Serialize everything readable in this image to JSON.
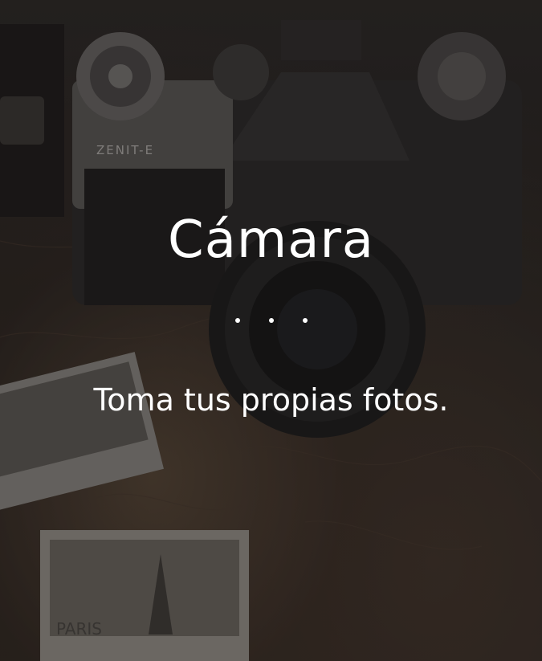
{
  "card": {
    "title": "Cámara",
    "subtitle": "Toma tus propias fotos.",
    "divider_dots": 3,
    "background_image": "camera-photo",
    "text_color": "#ffffff",
    "overlay_color": "#141211"
  }
}
